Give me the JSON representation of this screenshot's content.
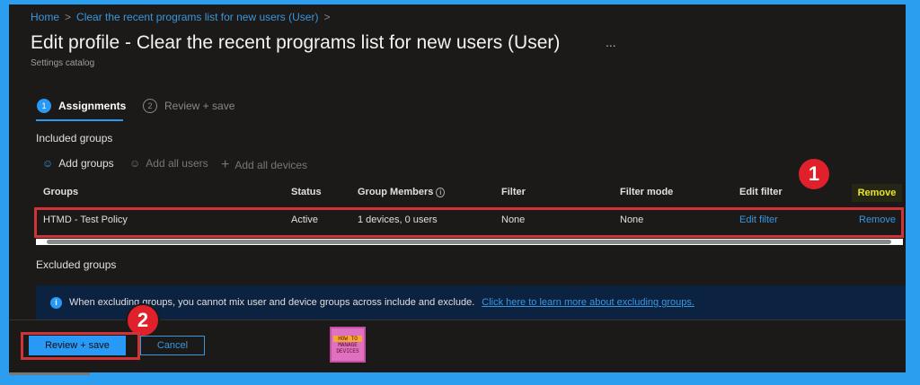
{
  "breadcrumb": [
    "Home",
    "Clear the recent programs list for new users (User)"
  ],
  "title": "Edit profile - Clear the recent programs list for new users (User)",
  "more_icon": "...",
  "subtitle": "Settings catalog",
  "steps": [
    {
      "num": "1",
      "label": "Assignments",
      "active": true
    },
    {
      "num": "2",
      "label": "Review + save",
      "active": false
    }
  ],
  "included_title": "Included groups",
  "actions": {
    "add_groups": "Add groups",
    "add_all_users": "Add all users",
    "add_all_devices": "Add all devices"
  },
  "columns": [
    "Groups",
    "Status",
    "Group Members",
    "Filter",
    "Filter mode",
    "Edit filter",
    "Remove"
  ],
  "row": {
    "group": "HTMD - Test Policy",
    "status": "Active",
    "members": "1 devices, 0 users",
    "filter": "None",
    "filter_mode": "None",
    "edit_filter": "Edit filter",
    "remove": "Remove"
  },
  "excluded_title": "Excluded groups",
  "info": {
    "text": "When excluding groups, you cannot mix user and device groups across include and exclude.",
    "link": "Click here to learn more about excluding groups."
  },
  "buttons": {
    "review_save": "Review + save",
    "cancel": "Cancel"
  },
  "callouts": [
    "1",
    "2"
  ],
  "logo": {
    "line1": "HOW TO",
    "line2": "MANAGE",
    "line3": "DEVICES"
  },
  "colors": {
    "accent": "#2899f5",
    "callout": "#e0202a",
    "background": "#1b1a19"
  }
}
